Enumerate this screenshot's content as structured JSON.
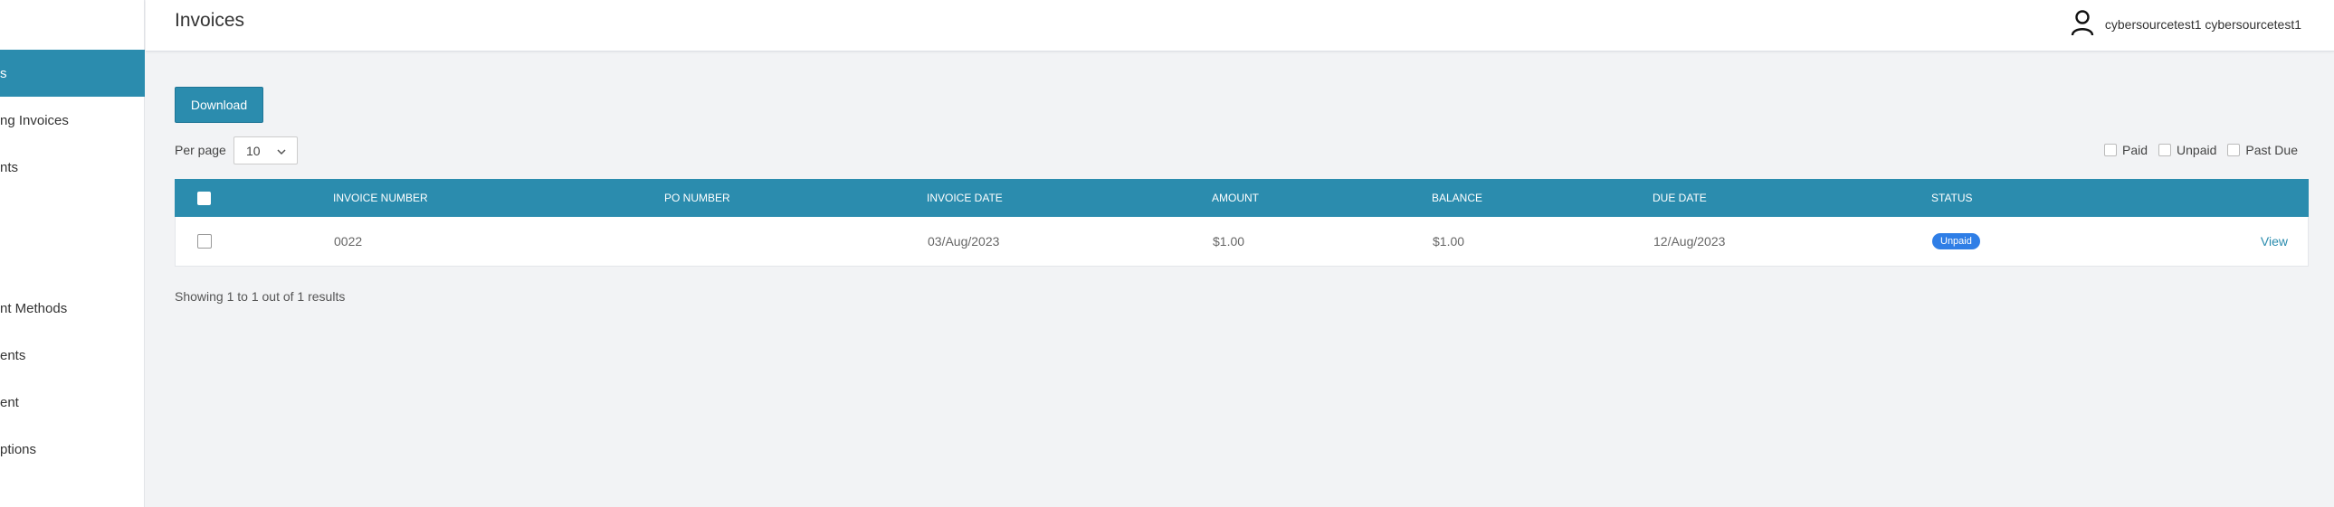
{
  "sidebar": {
    "items": [
      {
        "label": "s",
        "active": true
      },
      {
        "label": "ng Invoices",
        "active": false
      },
      {
        "label": "nts",
        "active": false
      },
      {
        "label": "nt Methods",
        "active": false
      },
      {
        "label": "ents",
        "active": false
      },
      {
        "label": "ent",
        "active": false
      },
      {
        "label": "ptions",
        "active": false
      }
    ]
  },
  "header": {
    "title": "Invoices",
    "user_name": "cybersourcetest1 cybersourcetest1",
    "user_icon": "user-icon"
  },
  "toolbar": {
    "download_label": "Download",
    "per_page_label": "Per page",
    "per_page_value": "10"
  },
  "filters": {
    "paid": "Paid",
    "unpaid": "Unpaid",
    "past_due": "Past Due"
  },
  "table": {
    "columns": [
      "INVOICE NUMBER",
      "PO NUMBER",
      "INVOICE DATE",
      "AMOUNT",
      "BALANCE",
      "DUE DATE",
      "STATUS"
    ],
    "rows": [
      {
        "invoice_number": "0022",
        "po_number": "",
        "invoice_date": "03/Aug/2023",
        "amount": "$1.00",
        "balance": "$1.00",
        "due_date": "12/Aug/2023",
        "status": "Unpaid",
        "action": "View"
      }
    ]
  },
  "results_text": "Showing 1 to 1 out of 1 results",
  "colors": {
    "accent": "#2b8cae",
    "badge_unpaid": "#2f7ee6",
    "background": "#f2f3f5"
  }
}
